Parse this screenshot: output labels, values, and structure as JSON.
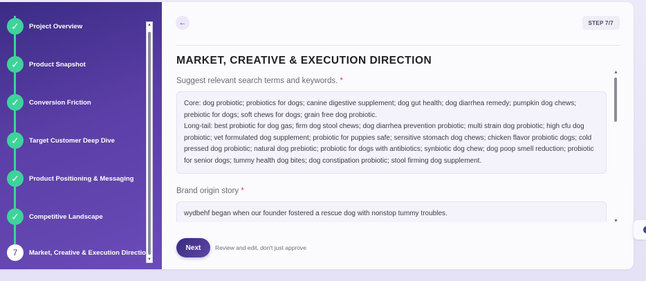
{
  "sidebar": {
    "steps": [
      {
        "label": "Project Overview",
        "status": "done",
        "icon": "check-icon"
      },
      {
        "label": "Product Snapshot",
        "status": "done",
        "icon": "check-icon"
      },
      {
        "label": "Conversion Friction",
        "status": "done",
        "icon": "check-icon"
      },
      {
        "label": "Target Customer Deep Dive",
        "status": "done",
        "icon": "check-icon"
      },
      {
        "label": "Product Positioning & Messaging",
        "status": "done",
        "icon": "check-icon"
      },
      {
        "label": "Competitive Landscape",
        "status": "done",
        "icon": "check-icon"
      },
      {
        "label": "Market, Creative & Execution Direction",
        "status": "current",
        "number": "7"
      }
    ],
    "check_glyph": "✓"
  },
  "header": {
    "back_glyph": "←",
    "step_badge": "STEP 7/7"
  },
  "main": {
    "title": "MARKET, CREATIVE & EXECUTION DIRECTION",
    "questions": [
      {
        "label": "Suggest relevant search terms and keywords.",
        "required_mark": "*",
        "answer_lines": [
          "Core: dog probiotic; probiotics for dogs; canine digestive supplement; dog gut health; dog diarrhea remedy; pumpkin dog chews; prebiotic for dogs; soft chews for dogs; grain free dog probiotic.",
          "Long-tail: best probiotic for dog gas; firm dog stool chews; dog diarrhea prevention probiotic; multi strain dog probiotic; high cfu dog probiotic; vet formulated dog supplement; probiotic for puppies safe; sensitive stomach dog chews; chicken flavor probiotic dogs; cold pressed dog probiotic; natural dog prebiotic; probiotic for dogs with antibiotics; synbiotic dog chew; dog poop smell reduction; probiotic for senior dogs; tummy health dog bites; dog constipation probiotic; stool firming dog supplement."
        ]
      },
      {
        "label": "Brand origin story",
        "required_mark": "*",
        "answer_lines": [
          "wydbehf began when our founder fostered a rescue dog with nonstop tummy troubles."
        ]
      }
    ]
  },
  "footer": {
    "next_label": "Next",
    "hint": "Review and edit, don't just approve"
  },
  "colors": {
    "sidebar_start": "#3b2c86",
    "sidebar_end": "#6a4bb8",
    "check_green": "#3ed39a",
    "accent": "#4b3a96",
    "required_red": "#e53a4a"
  }
}
